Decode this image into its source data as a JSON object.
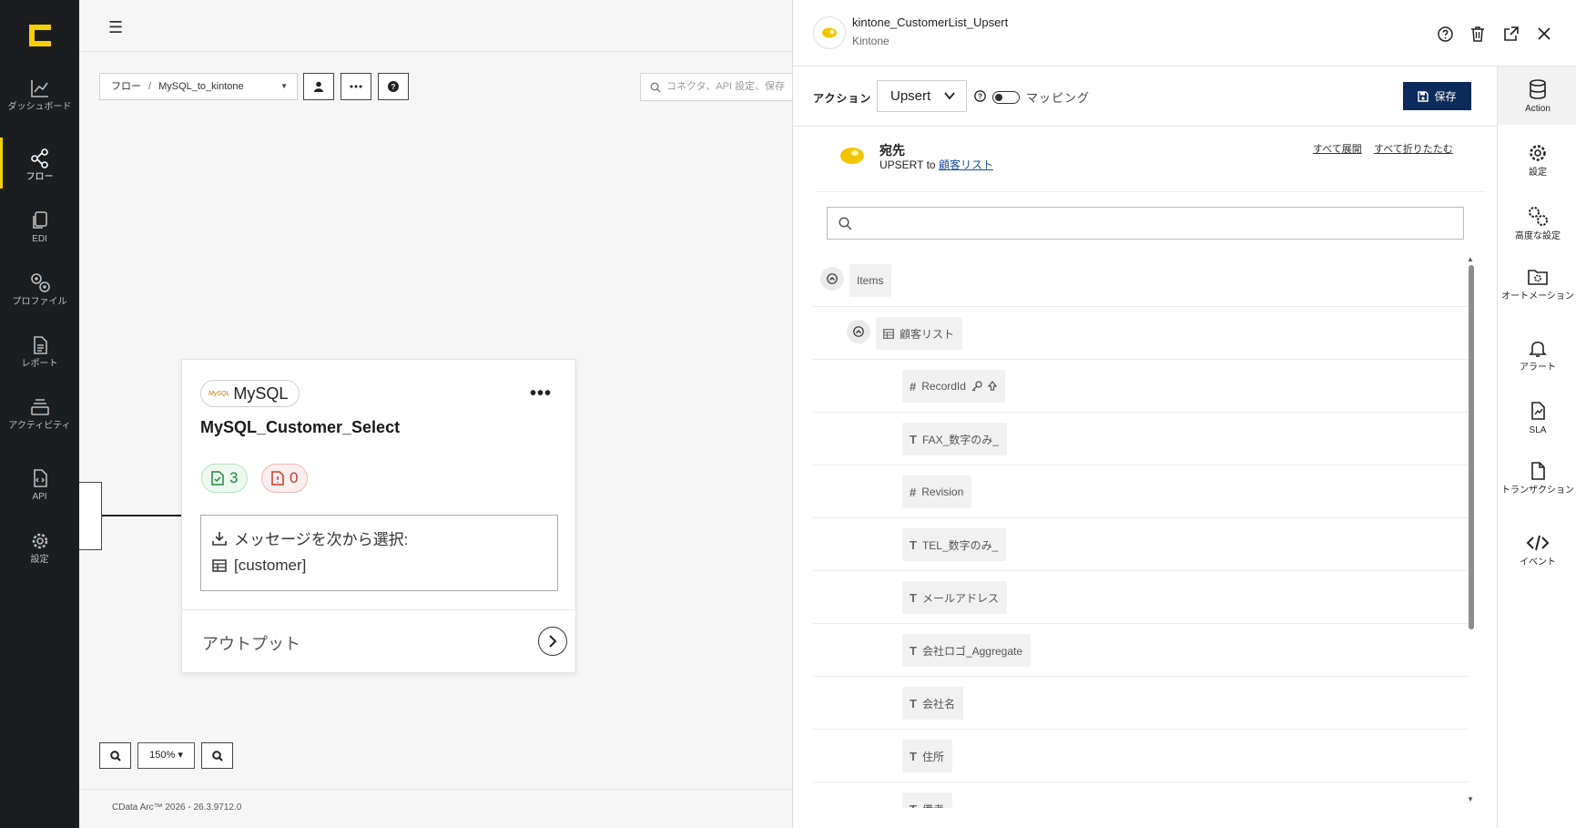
{
  "leftnav": {
    "items": [
      {
        "label": "ダッシュボード",
        "icon": "chart-line-icon"
      },
      {
        "label": "フロー",
        "icon": "share-nodes-icon"
      },
      {
        "label": "EDI",
        "icon": "documents-icon"
      },
      {
        "label": "プロファイル",
        "icon": "gears-icon"
      },
      {
        "label": "レポート",
        "icon": "report-icon"
      },
      {
        "label": "アクティビティ",
        "icon": "layers-icon"
      },
      {
        "label": "API",
        "icon": "api-file-icon"
      },
      {
        "label": "設定",
        "icon": "gear-icon"
      }
    ]
  },
  "canvas": {
    "breadcrumb_root": "フロー",
    "breadcrumb_sep": "/",
    "breadcrumb_current": "MySQL_to_kintone",
    "search_placeholder": "コネクタ、API 設定、保存",
    "zoom_value": "150%",
    "footer": "CData Arc™ 2026 - 26.3.9712.0"
  },
  "card": {
    "connector_label": "MySQL",
    "connector_logo_text": "MySQL",
    "title": "MySQL_Customer_Select",
    "success_count": "3",
    "error_count": "0",
    "message_label": "メッセージを次から選択:",
    "table_label": "[customer]",
    "output_label": "アウトプット"
  },
  "panel": {
    "connector_name": "kintone_CustomerList_Upsert",
    "connector_type": "Kintone",
    "action_label": "アクション",
    "action_value": "Upsert",
    "mapping_label": "マッピング",
    "save_label": "保存",
    "dest_title": "宛先",
    "dest_sub_prefix": "UPSERT to",
    "dest_sub_link": "顧客リスト",
    "expand_all": "すべて展開",
    "collapse_all": "すべて折りたたむ",
    "tree": [
      {
        "label": "Items",
        "type": "root"
      },
      {
        "label": "顧客リスト",
        "type": "table"
      },
      {
        "label": "RecordId",
        "type": "#"
      },
      {
        "label": "FAX_数字のみ_",
        "type": "T"
      },
      {
        "label": "Revision",
        "type": "#"
      },
      {
        "label": "TEL_数字のみ_",
        "type": "T"
      },
      {
        "label": "メールアドレス",
        "type": "T"
      },
      {
        "label": "会社ロゴ_Aggregate",
        "type": "T"
      },
      {
        "label": "会社名",
        "type": "T"
      },
      {
        "label": "住所",
        "type": "T"
      },
      {
        "label": "備考",
        "type": "T"
      }
    ]
  },
  "rightrail": {
    "items": [
      {
        "label": "Action",
        "icon": "database-icon"
      },
      {
        "label": "設定",
        "icon": "gear-icon"
      },
      {
        "label": "高度な設定",
        "icon": "gears-icon"
      },
      {
        "label": "オートメーション",
        "icon": "folder-gear-icon"
      },
      {
        "label": "アラート",
        "icon": "bell-icon"
      },
      {
        "label": "SLA",
        "icon": "sla-icon"
      },
      {
        "label": "トランザクション",
        "icon": "file-icon"
      },
      {
        "label": "イベント",
        "icon": "code-icon"
      }
    ]
  },
  "colors": {
    "nav_bg": "#1b1d1f",
    "brand_yellow": "#f6d100",
    "save_bg": "#0c2a5a",
    "success": "#1f8a3a",
    "error": "#c0392b"
  }
}
